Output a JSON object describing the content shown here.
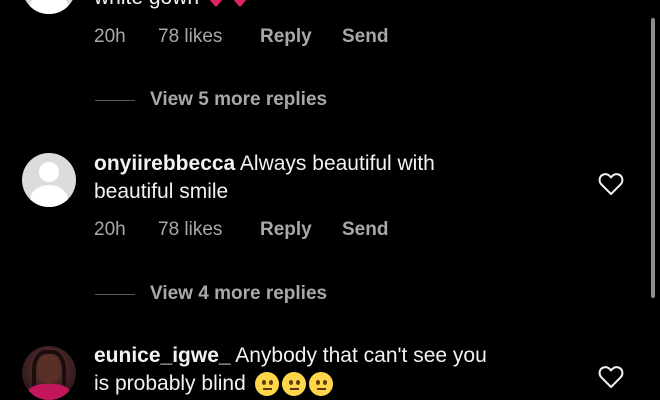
{
  "comments": [
    {
      "id": "c1",
      "partial_text": "white gown",
      "emoji": "red-heart-icon",
      "time": "20h",
      "likes": "78 likes",
      "reply_label": "Reply",
      "send_label": "Send",
      "view_replies": "View 5 more replies"
    },
    {
      "id": "c2",
      "username": "onyiirebbecca",
      "text_line1": " Always beautiful with",
      "text_line2": "beautiful smile",
      "time": "20h",
      "likes": "78 likes",
      "reply_label": "Reply",
      "send_label": "Send",
      "view_replies": "View 4 more replies"
    },
    {
      "id": "c3",
      "username": "eunice_igwe_",
      "text_line1": " Anybody that can't see you",
      "text_line2": "is probably blind",
      "emoji": "neutral-face-icon"
    }
  ],
  "colors": {
    "background": "#000000",
    "text": "#f2f2f2",
    "muted": "#a8a8a8",
    "heart_emoji": "#e0245e",
    "neutral_emoji": "#ffd54a"
  }
}
